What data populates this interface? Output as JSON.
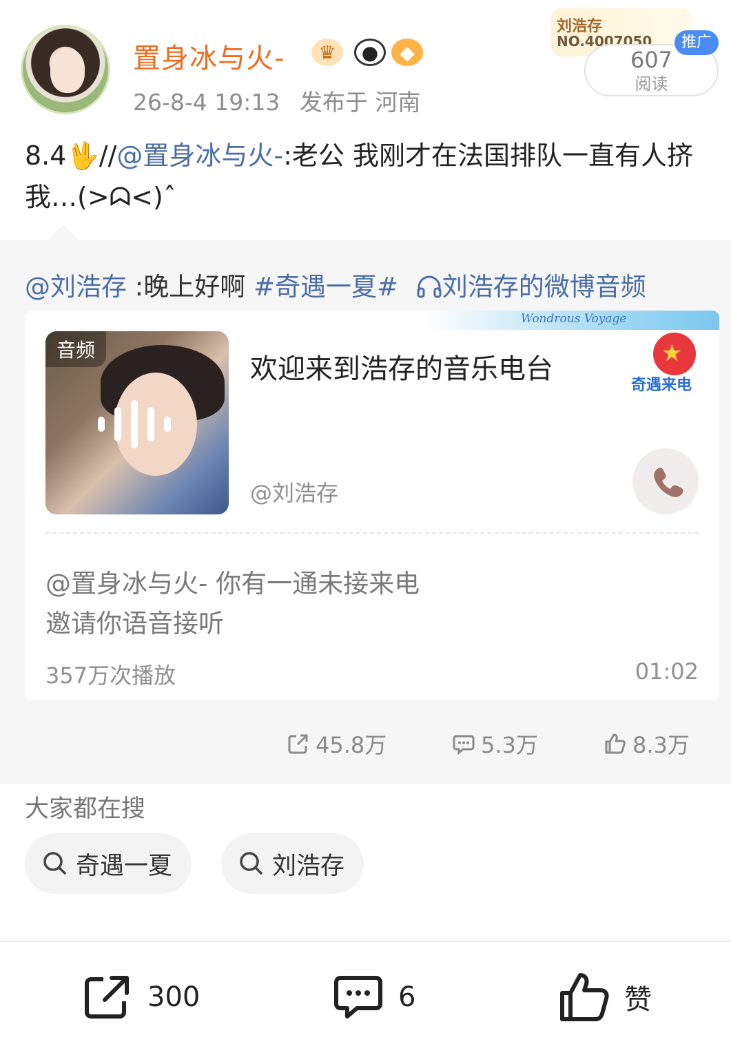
{
  "post": {
    "username": "置身冰与火-",
    "timestamp": "26-8-4 19:13",
    "location": "发布于 河南",
    "badges": [
      "crown-badge-icon",
      "panda-badge-icon",
      "fish-badge-icon"
    ],
    "text_prefix": "8.4",
    "text_emoji": "🖖",
    "text_sep": "//",
    "text_mention": "@置身冰与火-",
    "text_body": ":老公 我刚才在法国排队一直有人挤我…(>ᗣ<)ˆ"
  },
  "promo": {
    "name": "刘浩存",
    "number": "NO.4007050",
    "read_count": "607",
    "read_label": "阅读",
    "ad_tag": "推广"
  },
  "repost": {
    "mention": "@刘浩存",
    "text": " :晚上好啊 ",
    "hashtag": "#奇遇一夏#",
    "audio_link": "刘浩存的微博音频",
    "audio": {
      "cover_tag": "音频",
      "title": "欢迎来到浩存的音乐电台",
      "author": "@刘浩存",
      "deco_text": "Wondrous Voyage",
      "mascot_label": "奇遇来电",
      "invite_line1": "@置身冰与火- 你有一通未接来电",
      "invite_line2": "邀请你语音接听",
      "plays": "357万次播放",
      "duration": "01:02"
    },
    "stats": {
      "reposts": "45.8万",
      "comments": "5.3万",
      "likes": "8.3万"
    }
  },
  "search": {
    "title": "大家都在搜",
    "chips": [
      "奇遇一夏",
      "刘浩存"
    ]
  },
  "bottom_bar": {
    "repost_count": "300",
    "comment_count": "6",
    "like_label": "赞"
  },
  "colors": {
    "username": "#f06b1e",
    "link": "#4b6ea8",
    "ad_tag": "#4a8cf7",
    "repost_bg": "#f6f6f6"
  }
}
